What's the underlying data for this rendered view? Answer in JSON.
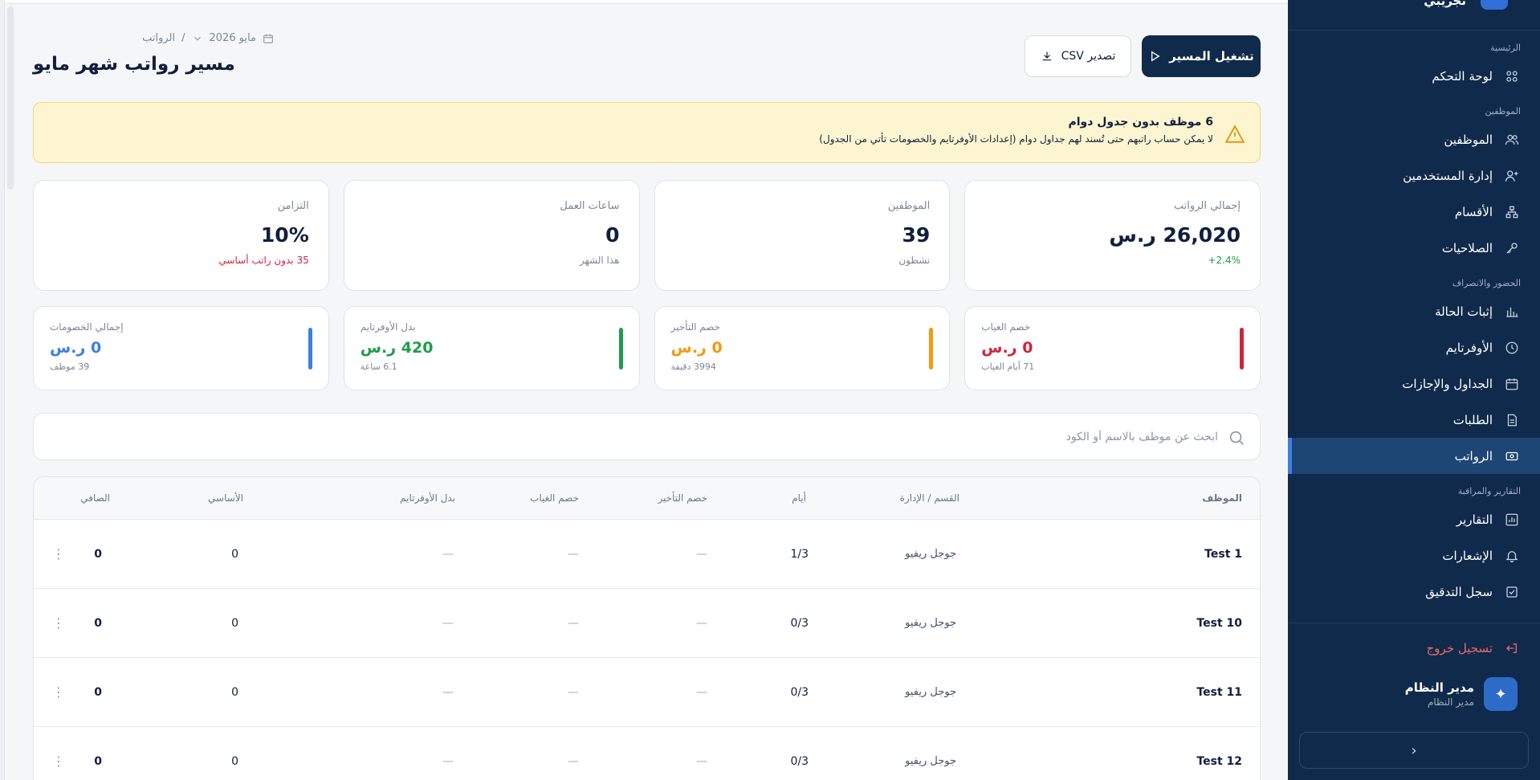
{
  "sidebar": {
    "brand": "تجريبي",
    "sections": {
      "main": "الرئيسية",
      "employees": "الموظفين",
      "attendance": "الحضور والانصراف",
      "reports": "التقارير والمراقبة"
    },
    "items": {
      "dashboard": "لوحة التحكم",
      "employees": "الموظفين",
      "users": "إدارة المستخدمين",
      "departments": "الأقسام",
      "permissions": "الصلاحيات",
      "status": "إثبات الحالة",
      "overtime": "الأوفرتايم",
      "schedules": "الجداول والإجازات",
      "requests": "الطلبات",
      "payroll": "الرواتب",
      "reports": "التقارير",
      "notifications": "الإشعارات",
      "audit": "سجل التدقيق"
    },
    "logout": "تسجيل خروج",
    "user": {
      "name": "مدير النظام",
      "role": "مدير النظام"
    },
    "collapse_icon": "‹"
  },
  "header": {
    "breadcrumb_root": "الرواتب",
    "breadcrumb_sep": "/",
    "period": "مايو 2026",
    "title": "مسير رواتب شهر مايو",
    "run_label": "تشغيل المسير",
    "csv_label": "تصدير CSV"
  },
  "alert": {
    "title": "6 موظف بدون جدول دوام",
    "message": "لا يمكن حساب راتبهم حتى تُسند لهم جداول دوام (إعدادات الأوفرتايم والخصومات تأتي من الجدول)"
  },
  "stats": [
    {
      "label": "إجمالي الرواتب",
      "value": "26,020 ر.س",
      "sub": "2.4%+",
      "tone": "green"
    },
    {
      "label": "الموظفين",
      "value": "39",
      "sub": "نشطون",
      "tone": "muted"
    },
    {
      "label": "ساعات العمل",
      "value": "0",
      "sub": "هذا الشهر",
      "tone": "muted"
    },
    {
      "label": "التزامن",
      "value": "10%",
      "sub": "35 بدون راتب أساسي",
      "tone": "red"
    }
  ],
  "deductions": [
    {
      "label": "خصم الغياب",
      "value": "0 ر.س",
      "sub": "71 أيام الغياب",
      "color": "#d1243b"
    },
    {
      "label": "خصم التأخير",
      "value": "0 ر.س",
      "sub": "3994 دقيقة",
      "color": "#f29a0f"
    },
    {
      "label": "بدل الأوفرتايم",
      "value": "420 ر.س",
      "sub": "6.1 ساعة",
      "color": "#1f9d4a"
    },
    {
      "label": "إجمالي الخصومات",
      "value": "0 ر.س",
      "sub": "39 موظف",
      "color": "#3d7fe0"
    }
  ],
  "search": {
    "placeholder": "ابحث عن موظف بالاسم أو الكود",
    "value": ""
  },
  "table": {
    "columns": {
      "employee": "الموظف",
      "dept": "القسم / الإدارة",
      "days": "أيام",
      "late": "خصم التأخير",
      "absence": "خصم الغياب",
      "overtime": "بدل الأوفرتايم",
      "basic": "الأساسي",
      "net": "الصافي"
    },
    "rows": [
      {
        "employee": "Test 1",
        "dept": "جوجل ريفيو",
        "days": "1/3",
        "late": "—",
        "absence": "—",
        "overtime": "—",
        "basic": "0",
        "net": "0",
        "menu": "⋮"
      },
      {
        "employee": "Test 10",
        "dept": "جوجل ريفيو",
        "days": "0/3",
        "late": "—",
        "absence": "—",
        "overtime": "—",
        "basic": "0",
        "net": "0",
        "menu": "⋮"
      },
      {
        "employee": "Test 11",
        "dept": "جوجل ريفيو",
        "days": "0/3",
        "late": "—",
        "absence": "—",
        "overtime": "—",
        "basic": "0",
        "net": "0",
        "menu": "⋮"
      },
      {
        "employee": "Test 12",
        "dept": "جوجل ريفيو",
        "days": "0/3",
        "late": "—",
        "absence": "—",
        "overtime": "—",
        "basic": "0",
        "net": "0",
        "menu": "⋮"
      }
    ]
  }
}
